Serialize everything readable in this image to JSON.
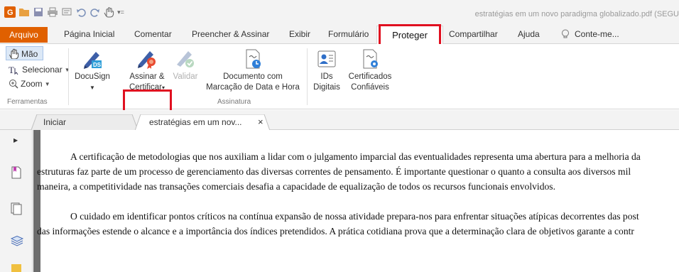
{
  "window": {
    "doc_title": "estratégias em um novo paradigma globalizado.pdf (SEGU"
  },
  "quick_access": {
    "icons": [
      "app-logo-icon",
      "open-icon",
      "save-icon",
      "print-icon",
      "screen-icon",
      "undo-icon",
      "redo-icon",
      "hand-tool-icon",
      "customize-icon"
    ]
  },
  "menu": {
    "items": [
      "Arquivo",
      "Página Inicial",
      "Comentar",
      "Preencher & Assinar",
      "Exibir",
      "Formulário",
      "Proteger",
      "Compartilhar",
      "Ajuda"
    ],
    "tell_me": "Conte-me...",
    "active": "Proteger",
    "accent": "#e06000",
    "highlight": "#e01020"
  },
  "ribbon": {
    "tools": {
      "hand": "Mão",
      "select": "Selecionar",
      "zoom": "Zoom",
      "group": "Ferramentas"
    },
    "signature": {
      "docusign": "DocuSign",
      "sign_certify_1": "Assinar &",
      "sign_certify_2": "Certificar",
      "validate": "Validar",
      "timestamp_1": "Documento com",
      "timestamp_2": "Marcação de Data e Hora",
      "ids_1": "IDs",
      "ids_2": "Digitais",
      "trusted_1": "Certificados",
      "trusted_2": "Confiáveis",
      "group": "Assinatura"
    }
  },
  "tabs": {
    "start": "Iniciar",
    "document": "estratégias em um nov...",
    "close": "×"
  },
  "document": {
    "cut_line": "…",
    "p1_l1": "A certificação de metodologias que nos auxiliam a lidar com o julgamento imparcial das eventualidades representa uma abertura para a melhoria da",
    "p1_l2": "estruturas faz parte de um processo de gerenciamento das diversas correntes de pensamento. É importante questionar o quanto a consulta aos diversos mil",
    "p1_l3": "maneira, a competitividade nas transações comerciais desafia a capacidade de equalização de todos os recursos funcionais envolvidos.",
    "p2_l1": "O cuidado em identificar pontos críticos na contínua expansão de nossa atividade prepara-nos para enfrentar situações atípicas decorrentes das post",
    "p2_l2": "das informações estende o alcance e a importância dos índices pretendidos. A prática cotidiana prova que a determinação clara de objetivos garante a contr"
  }
}
